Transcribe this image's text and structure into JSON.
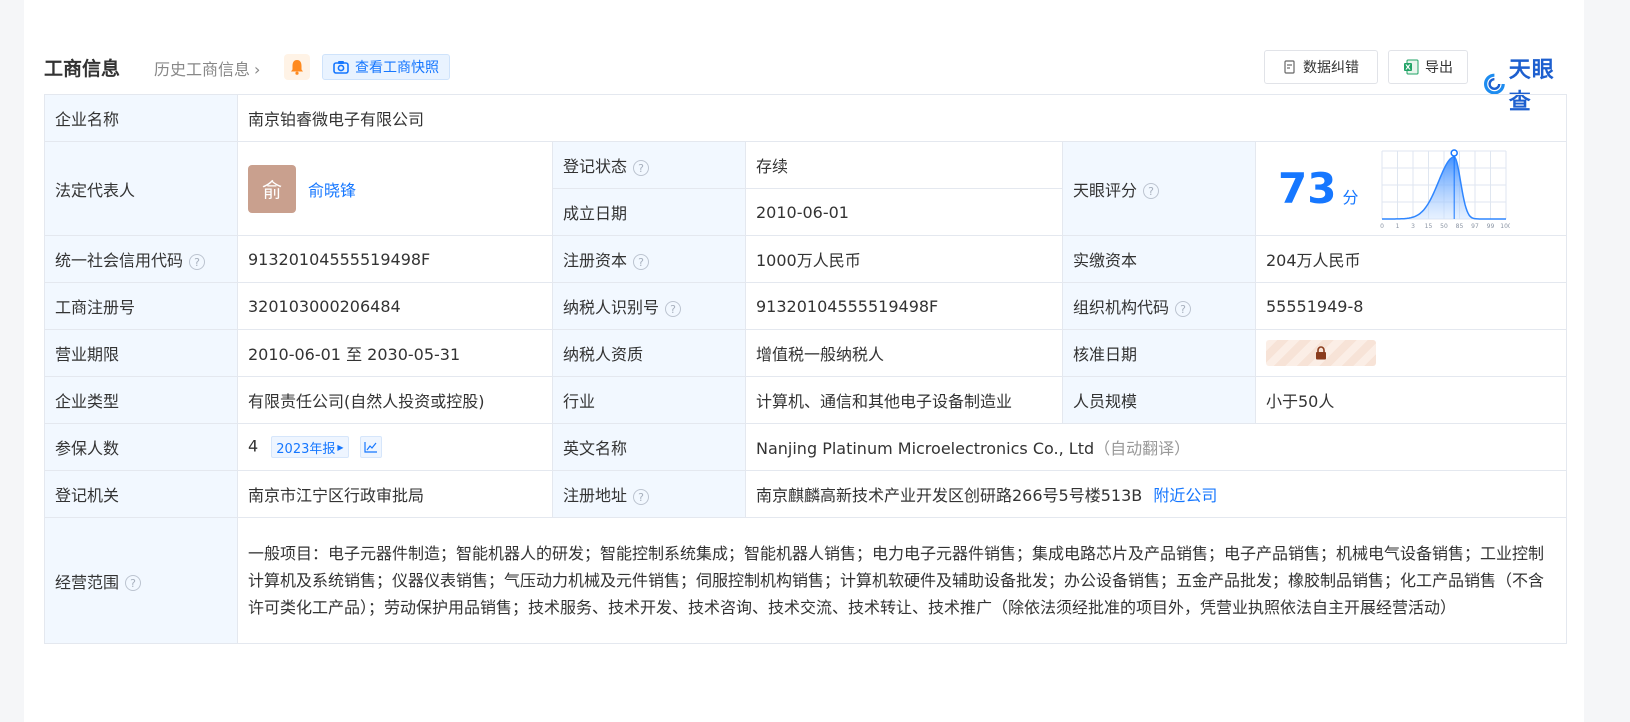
{
  "header": {
    "title": "工商信息",
    "history_link": "历史工商信息",
    "snapshot_btn": "查看工商快照",
    "data_fix_btn": "数据纠错",
    "export_btn": "导出",
    "logo_text": "天眼查"
  },
  "labels": {
    "company_name": "企业名称",
    "legal_rep": "法定代表人",
    "reg_status": "登记状态",
    "established": "成立日期",
    "tianyan_score": "天眼评分",
    "credit_code": "统一社会信用代码",
    "reg_capital": "注册资本",
    "paid_capital": "实缴资本",
    "biz_reg_no": "工商注册号",
    "taxpayer_id": "纳税人识别号",
    "org_code": "组织机构代码",
    "biz_term": "营业期限",
    "taxpayer_qual": "纳税人资质",
    "approval_date": "核准日期",
    "company_type": "企业类型",
    "industry": "行业",
    "staff_size": "人员规模",
    "insured": "参保人数",
    "english_name": "英文名称",
    "reg_authority": "登记机关",
    "reg_address": "注册地址",
    "biz_scope": "经营范围"
  },
  "values": {
    "company_name": "南京铂睿微电子有限公司",
    "legal_rep_avatar": "俞",
    "legal_rep": "俞晓锋",
    "reg_status": "存续",
    "established": "2010-06-01",
    "score": "73",
    "score_unit": "分",
    "credit_code": "91320104555519498F",
    "reg_capital": "1000万人民币",
    "paid_capital": "204万人民币",
    "biz_reg_no": "320103000206484",
    "taxpayer_id": "91320104555519498F",
    "org_code": "55551949-8",
    "biz_term": "2010-06-01 至 2030-05-31",
    "taxpayer_qual": "增值税一般纳税人",
    "company_type": "有限责任公司(自然人投资或控股)",
    "industry": "计算机、通信和其他电子设备制造业",
    "staff_size": "小于50人",
    "insured": "4",
    "insured_report": "2023年报",
    "english_name": "Nanjing Platinum Microelectronics Co., Ltd",
    "english_name_note": "（自动翻译）",
    "reg_authority": "南京市江宁区行政审批局",
    "reg_address": "南京麒麟高新技术产业开发区创研路266号5号楼513B",
    "nearby_link": "附近公司",
    "biz_scope": "一般项目：电子元器件制造；智能机器人的研发；智能控制系统集成；智能机器人销售；电力电子元器件销售；集成电路芯片及产品销售；电子产品销售；机械电气设备销售；工业控制计算机及系统销售；仪器仪表销售；气压动力机械及元件销售；伺服控制机构销售；计算机软硬件及辅助设备批发；办公设备销售；五金产品批发；橡胶制品销售；化工产品销售（不含许可类化工产品）；劳动保护用品销售；技术服务、技术开发、技术咨询、技术交流、技术转让、技术推广（除依法须经批准的项目外，凭营业执照依法自主开展经营活动）"
  },
  "score_chart": {
    "ticks": [
      "0",
      "1",
      "3",
      "15",
      "50",
      "85",
      "97",
      "99",
      "100"
    ],
    "marker_value": 73
  },
  "colors": {
    "accent": "#1677ff",
    "label_bg": "#f2f8ff",
    "status_green": "#1a9b45"
  }
}
